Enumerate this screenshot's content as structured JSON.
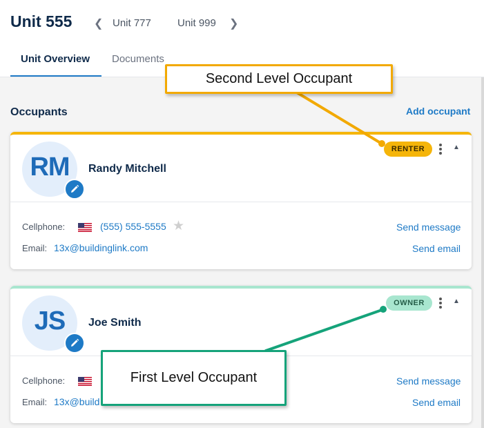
{
  "header": {
    "title": "Unit 555",
    "nav": {
      "prev_icon": "chevron-left-icon",
      "next_icon": "chevron-right-icon",
      "links": [
        "Unit 777",
        "Unit 999"
      ]
    }
  },
  "tabs": [
    {
      "label": "Unit Overview",
      "active": true
    },
    {
      "label": "Documents",
      "active": false
    }
  ],
  "section": {
    "title": "Occupants",
    "add_label": "Add occupant"
  },
  "occupants": [
    {
      "initials": "RM",
      "name": "Randy Mitchell",
      "badge": "RENTER",
      "badge_color": "#f5b50a",
      "phone_label": "Cellphone:",
      "phone": "(555) 555-5555",
      "email_label": "Email:",
      "email": "13x@buildinglink.com",
      "send_message": "Send message",
      "send_email": "Send email"
    },
    {
      "initials": "JS",
      "name": "Joe Smith",
      "badge": "OWNER",
      "badge_color": "#a8e6cf",
      "phone_label": "Cellphone:",
      "email_label": "Email:",
      "email_visible": "13x@build",
      "send_message": "Send message",
      "send_email": "Send email"
    }
  ],
  "callouts": {
    "second": "Second Level Occupant",
    "first": "First Level Occupant"
  },
  "colors": {
    "accent": "#1e7ac6",
    "renter": "#f5b50a",
    "owner": "#a8e6cf",
    "callout_second": "#f2a900",
    "callout_first": "#15a37a"
  }
}
